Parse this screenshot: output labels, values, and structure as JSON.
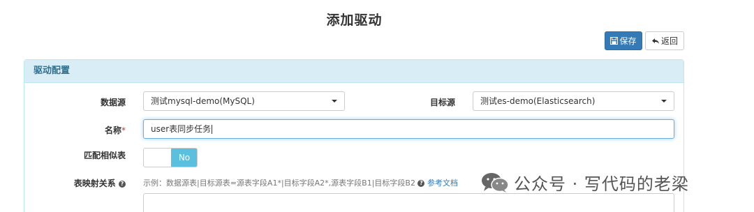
{
  "header": {
    "title": "添加驱动"
  },
  "toolbar": {
    "save_label": "保存",
    "back_label": "返回"
  },
  "panel": {
    "title": "驱动配置"
  },
  "form": {
    "source_label": "数据源",
    "source_value": "测试mysql-demo(MySQL)",
    "target_label": "目标源",
    "target_value": "测试es-demo(Elasticsearch)",
    "name_label": "名称",
    "name_required": "*",
    "name_value": "user表同步任务",
    "match_label": "匹配相似表",
    "match_toggle": "No",
    "mapping_label": "表映射关系",
    "mapping_hint": "示例：数据源表|目标源表=源表字段A1*|目标字段A2*,源表字段B1|目标字段B2",
    "mapping_link": "参考文档"
  },
  "watermark": {
    "text": "公众号 · 写代码的老梁"
  }
}
